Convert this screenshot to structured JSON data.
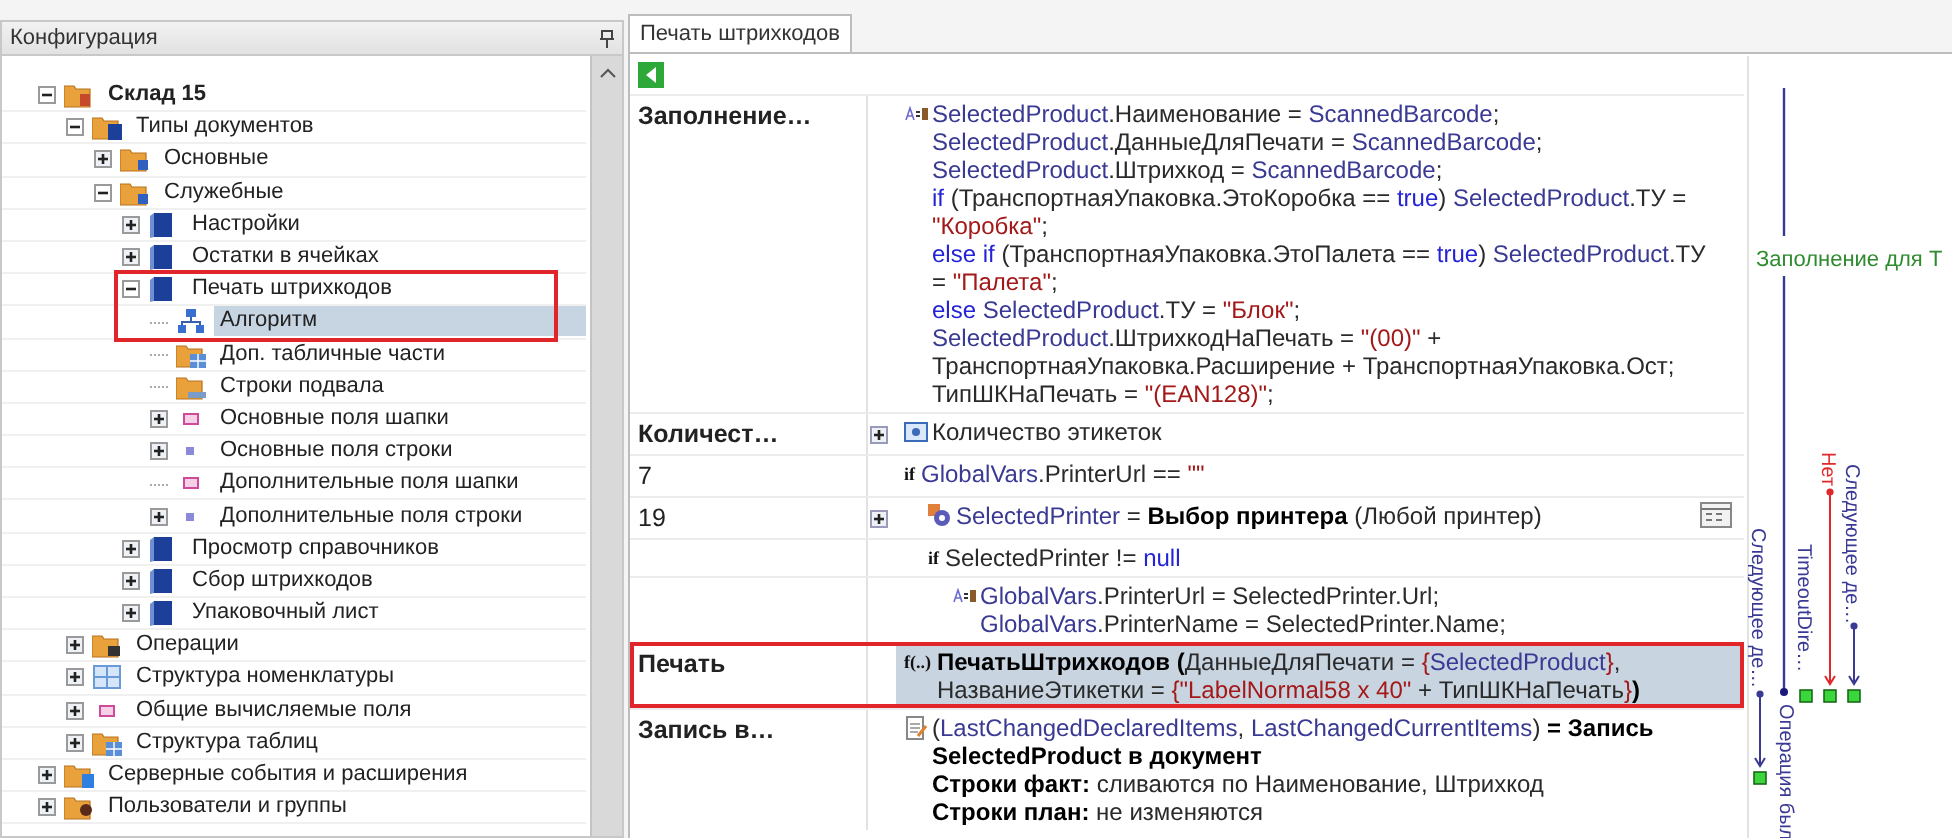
{
  "left_panel": {
    "title": "Конфигурация",
    "tree": [
      {
        "label": "Склад 15",
        "kind": "root",
        "bold": true,
        "expandable": true,
        "expanded": true,
        "selected": false,
        "highlighted": false,
        "children": [
          {
            "label": "Типы документов",
            "kind": "doc-folder",
            "bold": false,
            "expandable": true,
            "expanded": true,
            "selected": false,
            "highlighted": false,
            "children": [
              {
                "label": "Основные",
                "kind": "folder",
                "bold": false,
                "expandable": true,
                "expanded": false,
                "selected": false,
                "highlighted": false
              },
              {
                "label": "Служебные",
                "kind": "folder",
                "bold": false,
                "expandable": true,
                "expanded": true,
                "selected": false,
                "highlighted": false,
                "children": [
                  {
                    "label": "Настройки",
                    "kind": "doc",
                    "bold": false,
                    "expandable": true,
                    "expanded": false,
                    "selected": false,
                    "highlighted": false
                  },
                  {
                    "label": "Остатки в ячейках",
                    "kind": "doc",
                    "bold": false,
                    "expandable": true,
                    "expanded": false,
                    "selected": false,
                    "highlighted": false
                  },
                  {
                    "label": "Печать штрихкодов",
                    "kind": "doc",
                    "bold": false,
                    "expandable": true,
                    "expanded": true,
                    "selected": false,
                    "highlighted": true,
                    "children": [
                      {
                        "label": "Алгоритм",
                        "kind": "algorithm",
                        "bold": false,
                        "expandable": false,
                        "selected": true,
                        "highlighted": true
                      },
                      {
                        "label": "Доп. табличные части",
                        "kind": "table",
                        "bold": false,
                        "expandable": false,
                        "selected": false,
                        "highlighted": false
                      },
                      {
                        "label": "Строки подвала",
                        "kind": "footer",
                        "bold": false,
                        "expandable": false,
                        "selected": false,
                        "highlighted": false
                      },
                      {
                        "label": "Основные поля шапки",
                        "kind": "field-pink",
                        "bold": false,
                        "expandable": true,
                        "expanded": false,
                        "selected": false,
                        "highlighted": false
                      },
                      {
                        "label": "Основные поля строки",
                        "kind": "field-blue",
                        "bold": false,
                        "expandable": true,
                        "expanded": false,
                        "selected": false,
                        "highlighted": false
                      },
                      {
                        "label": "Дополнительные поля шапки",
                        "kind": "field-pink",
                        "bold": false,
                        "expandable": false,
                        "selected": false,
                        "highlighted": false
                      },
                      {
                        "label": "Дополнительные поля строки",
                        "kind": "field-blue",
                        "bold": false,
                        "expandable": true,
                        "expanded": false,
                        "selected": false,
                        "highlighted": false
                      }
                    ]
                  },
                  {
                    "label": "Просмотр справочников",
                    "kind": "doc",
                    "bold": false,
                    "expandable": true,
                    "expanded": false,
                    "selected": false,
                    "highlighted": false
                  },
                  {
                    "label": "Сбор штрихкодов",
                    "kind": "doc",
                    "bold": false,
                    "expandable": true,
                    "expanded": false,
                    "selected": false,
                    "highlighted": false
                  },
                  {
                    "label": "Упаковочный лист",
                    "kind": "doc",
                    "bold": false,
                    "expandable": true,
                    "expanded": false,
                    "selected": false,
                    "highlighted": false
                  }
                ]
              }
            ]
          },
          {
            "label": "Операции",
            "kind": "ops",
            "bold": false,
            "expandable": true,
            "expanded": false,
            "selected": false,
            "highlighted": false
          },
          {
            "label": "Структура номенклатуры",
            "kind": "grid",
            "bold": false,
            "expandable": true,
            "expanded": false,
            "selected": false,
            "highlighted": false
          },
          {
            "label": "Общие вычисляемые поля",
            "kind": "field-pink",
            "bold": false,
            "expandable": true,
            "expanded": false,
            "selected": false,
            "highlighted": false
          },
          {
            "label": "Структура таблиц",
            "kind": "table",
            "bold": false,
            "expandable": true,
            "expanded": false,
            "selected": false,
            "highlighted": false
          }
        ]
      },
      {
        "label": "Серверные события и расширения",
        "kind": "server",
        "bold": false,
        "expandable": true,
        "expanded": false,
        "selected": false,
        "highlighted": false
      },
      {
        "label": "Пользователи и группы",
        "kind": "users",
        "bold": false,
        "expandable": true,
        "expanded": false,
        "selected": false,
        "highlighted": false
      }
    ]
  },
  "tabs": [
    {
      "label": "Печать штрихкодов",
      "selected": true
    }
  ],
  "steps": [
    {
      "label": "Заполнение…",
      "kind": "assign",
      "selected": false,
      "highlighted": false,
      "expandable": false,
      "lines": [
        [
          {
            "kind": "var",
            "text": "SelectedProduct"
          },
          {
            "kind": "plain",
            "text": ".Наименование = "
          },
          {
            "kind": "var",
            "text": "ScannedBarcode"
          },
          {
            "kind": "plain",
            "text": ";"
          }
        ],
        [
          {
            "kind": "var",
            "text": "SelectedProduct"
          },
          {
            "kind": "plain",
            "text": ".ДанныеДляПечати = "
          },
          {
            "kind": "var",
            "text": "ScannedBarcode"
          },
          {
            "kind": "plain",
            "text": ";"
          }
        ],
        [
          {
            "kind": "var",
            "text": "SelectedProduct"
          },
          {
            "kind": "plain",
            "text": ".Штрихкод = "
          },
          {
            "kind": "var",
            "text": "ScannedBarcode"
          },
          {
            "kind": "plain",
            "text": ";"
          }
        ],
        [
          {
            "kind": "kw",
            "text": "if"
          },
          {
            "kind": "plain",
            "text": " (ТранспортнаяУпаковка.ЭтоКоробка == "
          },
          {
            "kind": "kw",
            "text": "true"
          },
          {
            "kind": "plain",
            "text": ") "
          },
          {
            "kind": "var",
            "text": "SelectedProduct"
          },
          {
            "kind": "plain",
            "text": ".ТУ ="
          }
        ],
        [
          {
            "kind": "str",
            "text": "\"Коробка\""
          },
          {
            "kind": "plain",
            "text": ";"
          }
        ],
        [
          {
            "kind": "kw",
            "text": "else if"
          },
          {
            "kind": "plain",
            "text": " (ТранспортнаяУпаковка.ЭтоПалета == "
          },
          {
            "kind": "kw",
            "text": "true"
          },
          {
            "kind": "plain",
            "text": ") "
          },
          {
            "kind": "var",
            "text": "SelectedProduct"
          },
          {
            "kind": "plain",
            "text": ".ТУ"
          }
        ],
        [
          {
            "kind": "plain",
            "text": "= "
          },
          {
            "kind": "str",
            "text": "\"Палета\""
          },
          {
            "kind": "plain",
            "text": ";"
          }
        ],
        [
          {
            "kind": "kw",
            "text": "else "
          },
          {
            "kind": "var",
            "text": "SelectedProduct"
          },
          {
            "kind": "plain",
            "text": ".ТУ = "
          },
          {
            "kind": "str",
            "text": "\"Блок\""
          },
          {
            "kind": "plain",
            "text": ";"
          }
        ],
        [
          {
            "kind": "var",
            "text": "SelectedProduct"
          },
          {
            "kind": "plain",
            "text": ".ШтрихкодНаПечать = "
          },
          {
            "kind": "str",
            "text": "\"(00)\""
          },
          {
            "kind": "plain",
            "text": " +"
          }
        ],
        [
          {
            "kind": "plain",
            "text": "ТранспортнаяУпаковка.Расширение + ТранспортнаяУпаковка.Ост;"
          }
        ],
        [
          {
            "kind": "plain",
            "text": "ТипШКНаПечать =  "
          },
          {
            "kind": "str",
            "text": "\"(EAN128)\""
          },
          {
            "kind": "plain",
            "text": ";"
          }
        ]
      ]
    },
    {
      "label": "Количест…",
      "kind": "group",
      "selected": false,
      "highlighted": false,
      "expandable": true,
      "expanded": false,
      "lines": [
        [
          {
            "kind": "plain",
            "text": "Количество этикеток"
          }
        ]
      ]
    },
    {
      "label": "7",
      "kind": "condition",
      "marker": "if",
      "selected": false,
      "highlighted": false,
      "expandable": false,
      "lines": [
        [
          {
            "kind": "var",
            "text": "GlobalVars"
          },
          {
            "kind": "plain",
            "text": ".PrinterUrl == "
          },
          {
            "kind": "str",
            "text": "\"\""
          }
        ]
      ],
      "children": [
        {
          "label": "19",
          "kind": "dialog",
          "selected": false,
          "highlighted": false,
          "expandable": true,
          "expanded": false,
          "lines": [
            [
              {
                "kind": "var",
                "text": "SelectedPrinter"
              },
              {
                "kind": "plain",
                "text": " = "
              },
              {
                "kind": "bold",
                "text": "Выбор принтера"
              },
              {
                "kind": "plain",
                "text": " (Любой принтер)"
              }
            ]
          ]
        },
        {
          "kind": "condition",
          "marker": "if",
          "selected": false,
          "highlighted": false,
          "expandable": false,
          "lines": [
            [
              {
                "kind": "plain",
                "text": "SelectedPrinter != "
              },
              {
                "kind": "kw",
                "text": "null"
              }
            ]
          ],
          "children": [
            {
              "kind": "assign",
              "selected": false,
              "highlighted": false,
              "expandable": false,
              "lines": [
                [
                  {
                    "kind": "var",
                    "text": "GlobalVars"
                  },
                  {
                    "kind": "plain",
                    "text": ".PrinterUrl = SelectedPrinter.Url;"
                  }
                ],
                [
                  {
                    "kind": "var",
                    "text": "GlobalVars"
                  },
                  {
                    "kind": "plain",
                    "text": ".PrinterName = SelectedPrinter.Name;"
                  }
                ]
              ]
            }
          ]
        }
      ]
    },
    {
      "label": "Печать",
      "kind": "call",
      "marker": "f(..)",
      "selected": true,
      "highlighted": true,
      "expandable": false,
      "lines": [
        [
          {
            "kind": "bold",
            "text": "ПечатьШтрихкодов ("
          },
          {
            "kind": "plain",
            "text": "ДанныеДляПечати = "
          },
          {
            "kind": "str",
            "text": "{"
          },
          {
            "kind": "var",
            "text": "SelectedProduct"
          },
          {
            "kind": "str",
            "text": "}"
          },
          {
            "kind": "plain",
            "text": ","
          }
        ],
        [
          {
            "kind": "plain",
            "text": "НазваниеЭтикетки = "
          },
          {
            "kind": "str",
            "text": "{\"LabelNormal58 x 40\""
          },
          {
            "kind": "plain",
            "text": " + ТипШКНаПечать"
          },
          {
            "kind": "str",
            "text": "}"
          },
          {
            "kind": "bold",
            "text": ")"
          }
        ]
      ]
    },
    {
      "label": "Запись в…",
      "kind": "record",
      "selected": false,
      "highlighted": false,
      "expandable": false,
      "lines": [
        [
          {
            "kind": "plain",
            "text": "("
          },
          {
            "kind": "var",
            "text": "LastChangedDeclaredItems"
          },
          {
            "kind": "plain",
            "text": ", "
          },
          {
            "kind": "var",
            "text": "LastChangedCurrentItems"
          },
          {
            "kind": "plain",
            "text": ") "
          },
          {
            "kind": "bold",
            "text": "= Запись"
          }
        ],
        [
          {
            "kind": "bold",
            "text": "SelectedProduct в документ"
          }
        ],
        [
          {
            "kind": "bold",
            "text": "Строки факт:"
          },
          {
            "kind": "plain",
            "text": " сливаются по Наименование, Штрихкод"
          }
        ],
        [
          {
            "kind": "bold",
            "text": "Строки план:"
          },
          {
            "kind": "plain",
            "text": " не изменяются"
          }
        ]
      ]
    }
  ],
  "flow": {
    "title": "Заполнение для Т",
    "links": [
      {
        "label": "Нет",
        "kind": "no"
      },
      {
        "label": "Следующее де…",
        "kind": "next"
      },
      {
        "label": "TimeoutDire…",
        "kind": "timeout"
      },
      {
        "label": "Следующее де…",
        "kind": "next"
      },
      {
        "label": "Операция был",
        "kind": "done"
      }
    ]
  }
}
